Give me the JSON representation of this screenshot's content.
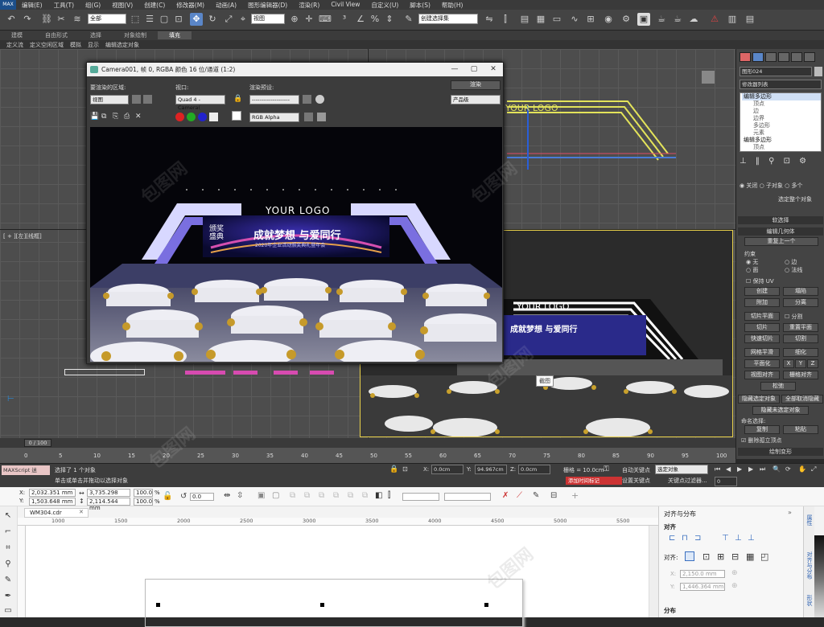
{
  "menu": {
    "logo": "MAX",
    "items": [
      "编辑(E)",
      "工具(T)",
      "组(G)",
      "视图(V)",
      "创建(C)",
      "修改器(M)",
      "动画(A)",
      "图形编辑器(D)",
      "渲染(R)",
      "Civil View",
      "自定义(U)",
      "脚本(S)",
      "帮助(H)"
    ]
  },
  "toolbar": {
    "filter_select": "全部",
    "refcoord_select": "视图",
    "selection_set": "创建选择集"
  },
  "ribbon": {
    "tabs": [
      "建模",
      "自由形式",
      "选择",
      "对象绘制",
      "填充"
    ],
    "active": 4,
    "sub_items": [
      "定义流",
      "定义空闲区域",
      "模拟",
      "显示",
      "编辑选定对象"
    ]
  },
  "viewport_labels": {
    "left": "[ + ][左][线框]"
  },
  "render_window": {
    "title": "Camera001, 帧 0, RGBA 颜色 16 位/通道 (1:2)",
    "area_label": "要渲染的区域:",
    "area_value": "视图",
    "viewport_label": "视口:",
    "viewport_value": "Quad 4 - Camera(",
    "preset_label": "渲染预设:",
    "preset_value": "--------------------",
    "render_button": "渲染",
    "quality_value": "产品级",
    "channel_value": "RGB Alpha"
  },
  "scene": {
    "logo_text": "YOUR LOGO",
    "banner_main": "成就梦想 与爱同行",
    "banner_left": "颁奖盛典",
    "banner_sub": "2020年企业活动颁奖典礼暨年会"
  },
  "top_viewport_logo": "YOUR LOGO",
  "camera_viewport": {
    "logo": "YOUR LOGO",
    "banner_main": "成就梦想 与爱同行",
    "tooltip": "截图"
  },
  "command_panel": {
    "object_name": "图形024",
    "modifier_list": "修改器列表",
    "stack": [
      "编辑多边形",
      "顶点",
      "边",
      "边界",
      "多边形",
      "元素",
      "编辑多边形",
      "顶点"
    ],
    "radio_off": "关闭",
    "radio_sub": "子对象",
    "radio_multi": "多个",
    "select_all": "选定整个对象",
    "soft_sel": "软选择",
    "edit_geom": "编辑几何体",
    "repeat_last": "重复上一个",
    "constraints": "约束",
    "c_none": "无",
    "c_edge": "边",
    "c_face": "面",
    "c_normal": "法线",
    "keep_uv": "保持 UV",
    "create": "创建",
    "collapse": "塌陷",
    "attach": "附加",
    "detach": "分离",
    "slice_plane": "切片平面",
    "split": "分割",
    "slice": "切片",
    "reset_plane": "重置平面",
    "quickslice": "快速切片",
    "cut": "切割",
    "meshsmooth": "网格平滑",
    "refine": "细化",
    "planarize": "平面化",
    "x": "X",
    "y": "Y",
    "z": "Z",
    "view_align": "视图对齐",
    "grid_align": "栅格对齐",
    "relax": "松弛",
    "hide_sel": "隐藏选定对象",
    "unhide_all": "全部取消隐藏",
    "hide_unsel": "隐藏未选定对象",
    "named_sel": "命名选择:",
    "copy": "复制",
    "paste": "粘贴",
    "delete_iso": "删除孤立顶点",
    "paint_deform": "绘制变形"
  },
  "timeline": {
    "frame": "0 / 100",
    "ticks": [
      "0",
      "5",
      "10",
      "15",
      "20",
      "25",
      "30",
      "35",
      "40",
      "45",
      "50",
      "55",
      "60",
      "65",
      "70",
      "75",
      "80",
      "85",
      "90",
      "95",
      "100"
    ]
  },
  "status": {
    "maxscript": "MAXScript 迷",
    "message": "选择了 1 个对象",
    "hint": "单击或单击并拖动以选择对象",
    "x_label": "X:",
    "x_value": "0.0cm",
    "y_label": "Y:",
    "y_value": "94.967cm",
    "z_label": "Z:",
    "z_value": "0.0cm",
    "grid": "栅格 = 10.0cm",
    "autokey": "自动关键点",
    "setkey": "设置关键点",
    "selected": "选定对象",
    "keyfilter": "关键点过滤器...",
    "addtime": "添加时间标记",
    "frame_value": "0"
  },
  "corel": {
    "x_label": "X:",
    "x_value": "2,032.351 mm",
    "y_label": "Y:",
    "y_value": "1,503.648 mm",
    "w_value": "3,735.298 mm",
    "h_value": "2,114.544 mm",
    "sx_value": "100.0",
    "sy_value": "100.0",
    "pct": "%",
    "angle_value": "0.0",
    "tab_name": "WM304.cdr",
    "ruler": [
      "1000",
      "1500",
      "2000",
      "2500",
      "3000",
      "3500",
      "4000",
      "4500",
      "5000",
      "5500"
    ],
    "docker_title": "对齐与分布",
    "align_label": "对齐",
    "align_to_label": "对齐:",
    "dx_label": "X:",
    "dx_value": "2,150.0 mm",
    "dy_label": "Y:",
    "dy_value": "1,446.364 mm",
    "distribute_label": "分布",
    "side_tabs": [
      "属性",
      "对齐与分布",
      "形状"
    ]
  },
  "colors": {
    "max_bg": "#4d4d4d",
    "corel_bg": "#f3f3f3",
    "accent": "#1c4f8a",
    "stage_purple": "#3a2a9a"
  }
}
